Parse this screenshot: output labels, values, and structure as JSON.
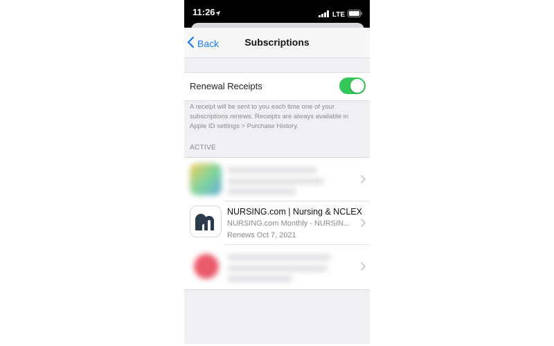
{
  "status_bar": {
    "time": "11:26",
    "network": "LTE"
  },
  "nav": {
    "back_label": "Back",
    "title": "Subscriptions"
  },
  "renewal": {
    "label": "Renewal Receipts",
    "enabled": true,
    "footnote": "A receipt will be sent to you each time one of your subscriptions renews. Receipts are always available in Apple ID settings > Purchase History."
  },
  "active_section": {
    "header": "ACTIVE",
    "items": [
      {
        "title": "",
        "plan": "",
        "renews": ""
      },
      {
        "title": "NURSING.com | Nursing & NCLEX",
        "plan": "NURSING.com Monthly - NURSIN...",
        "renews": "Renews Oct 7, 2021"
      },
      {
        "title": "",
        "plan": "",
        "renews": ""
      }
    ]
  },
  "colors": {
    "accent": "#1a7cf5",
    "toggle_on": "#34c759",
    "brand_icon": "#2b3a4d"
  }
}
